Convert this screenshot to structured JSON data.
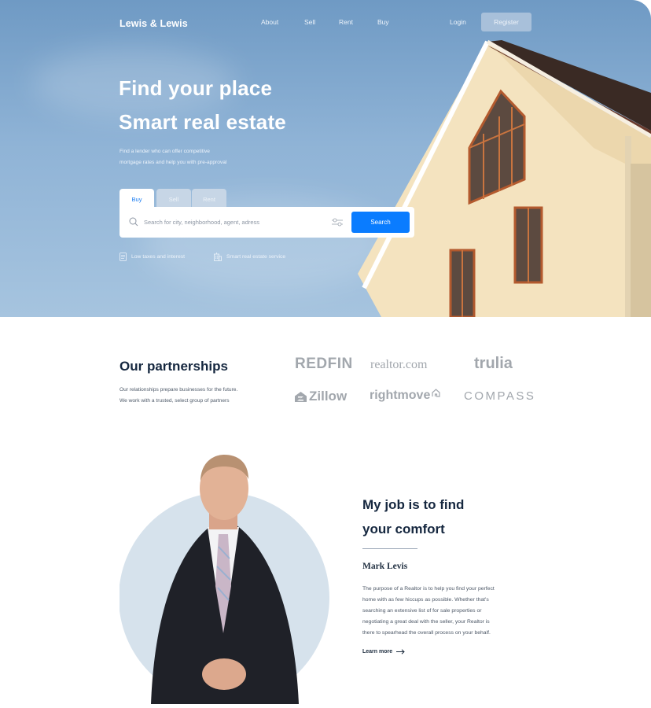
{
  "header": {
    "brand": "Lewis & Lewis",
    "nav": [
      "About",
      "Sell",
      "Rent",
      "Buy"
    ],
    "login": "Login",
    "register": "Register"
  },
  "hero": {
    "title_line1": "Find your place",
    "title_line2": "Smart real estate",
    "subtitle_line1": "Find a lender who can offer competitive",
    "subtitle_line2": "mortgage rates and help you with pre-approval",
    "tabs": [
      "Buy",
      "Sell",
      "Rent"
    ],
    "active_tab": "Buy",
    "search_placeholder": "Search for city, neighborhood, agent, adress",
    "search_value": "",
    "search_button": "Search",
    "features": [
      "Low taxes and interest",
      "Smart real estate service"
    ]
  },
  "partners": {
    "title": "Our partnerships",
    "desc_line1": "Our relationships prepare businesses for the future.",
    "desc_line2": "We work with a trusted, select group of partners",
    "logos": [
      "REDFIN",
      "realtor.com",
      "trulia",
      "Zillow",
      "rightmove",
      "COMPASS"
    ]
  },
  "agent": {
    "title_line1": "My job is to find",
    "title_line2": "your comfort",
    "name": "Mark Levis",
    "bio": [
      "The purpose of a Realtor is to help you find your perfect",
      "home with as few hiccups as possible. Whether that's",
      "searching an extensive list of for sale properties or",
      "negotiating a great deal with the seller, your Realtor is",
      "there to spearhead the overall process on your behalf."
    ],
    "learn_more": "Learn more"
  },
  "colors": {
    "accent": "#0a7cff",
    "heading": "#15273f",
    "logo_gray": "#a2a7ad"
  },
  "icons": {
    "search": "search-icon",
    "filter": "filter-sliders-icon",
    "feature1": "document-icon",
    "feature2": "building-icon",
    "learn_more": "arrow-right-icon"
  }
}
